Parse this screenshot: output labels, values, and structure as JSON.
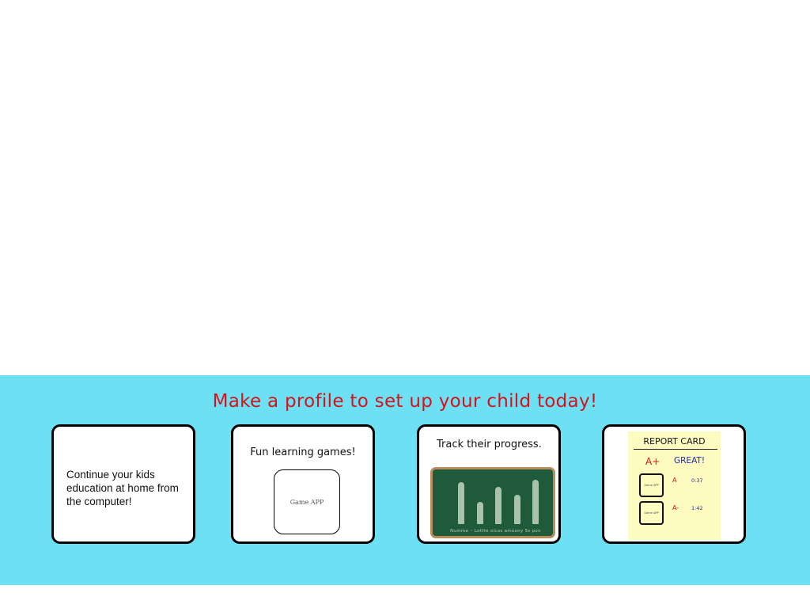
{
  "promo": {
    "headline": "Make a profile to set up your child today!",
    "colors": {
      "band": "#6ee0f4",
      "headline": "#d2141c",
      "card_border": "#000000",
      "chalkboard": "#1f5a3a",
      "chalkboard_frame": "#b88d5a",
      "report_paper": "#fdfbc0"
    },
    "cards": [
      {
        "text": "Continue your kids education at home from the computer!"
      },
      {
        "heading": "Fun learning games!",
        "app_label": "Game APP"
      },
      {
        "heading": "Track their progress.",
        "chart_labels": "Numme  ◦  Lottte      olcos      amoony  5s  pos",
        "bar_levels": [
          0.85,
          0.45,
          0.75,
          0.6,
          0.9
        ]
      },
      {
        "title": "REPORT CARD",
        "overall_grade": "A+",
        "overall_comment": "GREAT!",
        "rows": [
          {
            "app_label": "Game APP",
            "grade": "A",
            "time": "0:37"
          },
          {
            "app_label": "Game APP",
            "grade": "A-",
            "time": "1:42"
          }
        ]
      }
    ]
  }
}
